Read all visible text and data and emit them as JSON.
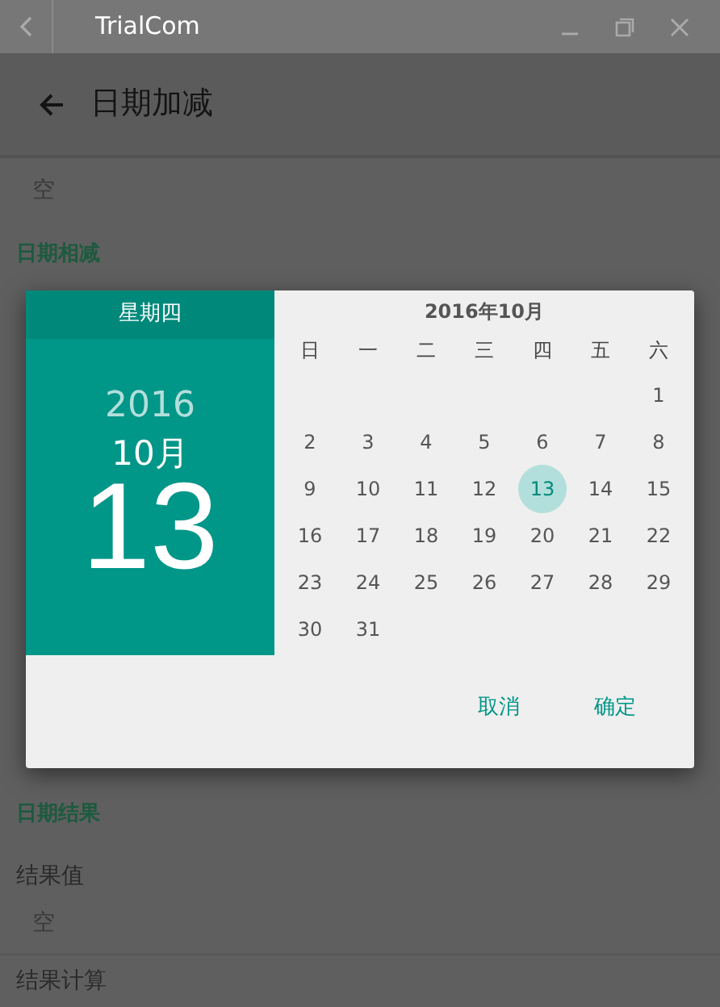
{
  "window": {
    "title": "TrialCom"
  },
  "app_bar": {
    "title": "日期加减"
  },
  "background_top": [
    {
      "kind": "value",
      "text": "空"
    },
    {
      "kind": "section",
      "text": "日期相减"
    }
  ],
  "background_bottom": [
    {
      "kind": "section",
      "text": "日期结果"
    },
    {
      "kind": "label",
      "text": "结果值"
    },
    {
      "kind": "value",
      "text": "空"
    },
    {
      "kind": "label",
      "text": "结果计算"
    }
  ],
  "dialog": {
    "weekday": "星期四",
    "year": "2016",
    "month": "10月",
    "day": "13",
    "calendar_title": "2016年10月",
    "weekdays": [
      "日",
      "一",
      "二",
      "三",
      "四",
      "五",
      "六"
    ],
    "weeks": [
      [
        {
          "label": "1",
          "selected": false
        }
      ],
      [
        {
          "label": "2",
          "selected": false
        },
        {
          "label": "3",
          "selected": false
        },
        {
          "label": "4",
          "selected": false
        },
        {
          "label": "5",
          "selected": false
        },
        {
          "label": "6",
          "selected": false
        },
        {
          "label": "7",
          "selected": false
        },
        {
          "label": "8",
          "selected": false
        }
      ],
      [
        {
          "label": "9",
          "selected": false
        },
        {
          "label": "10",
          "selected": false
        },
        {
          "label": "11",
          "selected": false
        },
        {
          "label": "12",
          "selected": false
        },
        {
          "label": "13",
          "selected": true
        },
        {
          "label": "14",
          "selected": false
        },
        {
          "label": "15",
          "selected": false
        }
      ],
      [
        {
          "label": "16",
          "selected": false
        },
        {
          "label": "17",
          "selected": false
        },
        {
          "label": "18",
          "selected": false
        },
        {
          "label": "19",
          "selected": false
        },
        {
          "label": "20",
          "selected": false
        },
        {
          "label": "21",
          "selected": false
        },
        {
          "label": "22",
          "selected": false
        }
      ],
      [
        {
          "label": "23",
          "selected": false
        },
        {
          "label": "24",
          "selected": false
        },
        {
          "label": "25",
          "selected": false
        },
        {
          "label": "26",
          "selected": false
        },
        {
          "label": "27",
          "selected": false
        },
        {
          "label": "28",
          "selected": false
        },
        {
          "label": "29",
          "selected": false
        }
      ],
      [
        {
          "label": "30",
          "selected": false
        },
        {
          "label": "31",
          "selected": false
        }
      ]
    ],
    "buttons": [
      "取消",
      "确定"
    ]
  }
}
